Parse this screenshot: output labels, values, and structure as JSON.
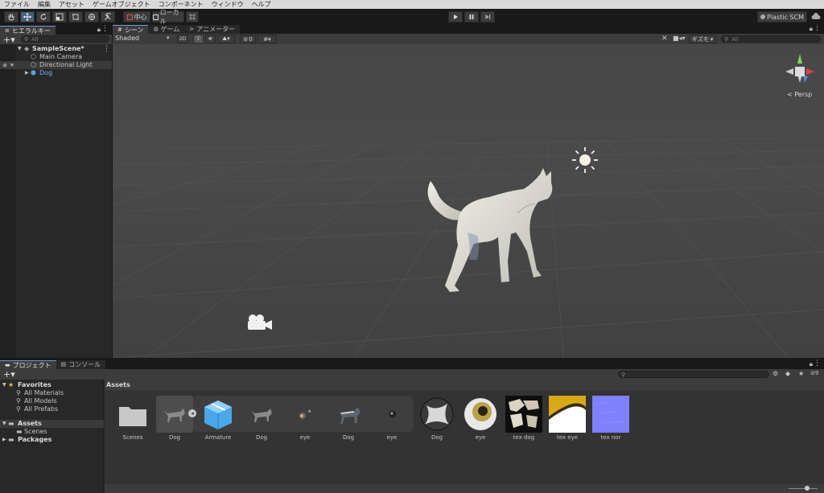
{
  "menu": [
    "ファイル",
    "編集",
    "アセット",
    "ゲームオブジェクト",
    "コンポーネント",
    "ウィンドウ",
    "ヘルプ"
  ],
  "toolbar": {
    "pivot_label": "中心",
    "space_label": "ローカル",
    "plastic_label": "Plastic SCM"
  },
  "hierarchy": {
    "tab_label": "ヒエラルキー",
    "search_placeholder": "All",
    "scene_name": "SampleScene*",
    "items": [
      "Main Camera",
      "Directional Light",
      "Dog"
    ]
  },
  "scene_view": {
    "tabs": [
      "シーン",
      "ゲーム",
      "アニメーター"
    ],
    "shading_mode": "Shaded",
    "mode_2d": "2D",
    "hidden_count": "0",
    "gizmos_label": "ギズモ",
    "search_placeholder": "All",
    "persp_label": "< Persp"
  },
  "project": {
    "tabs": [
      "プロジェクト",
      "コンソール"
    ],
    "hidden_count": "9",
    "favorites_label": "Favorites",
    "favorites": [
      "All Materials",
      "All Models",
      "All Prefabs"
    ],
    "assets_label": "Assets",
    "asset_folders": [
      "Scenes"
    ],
    "packages_label": "Packages",
    "breadcrumb": "Assets",
    "tiles": [
      "Scenes",
      "Dog",
      "Armature",
      "Dog",
      "eye",
      "Dog",
      "eye",
      "Dog",
      "eye",
      "tex dog",
      "tex eye",
      "tex nor"
    ]
  },
  "colors": {
    "accent": "#46607c",
    "selection_text": "#7cb0f0",
    "favorites_star": "#e8c23a"
  }
}
